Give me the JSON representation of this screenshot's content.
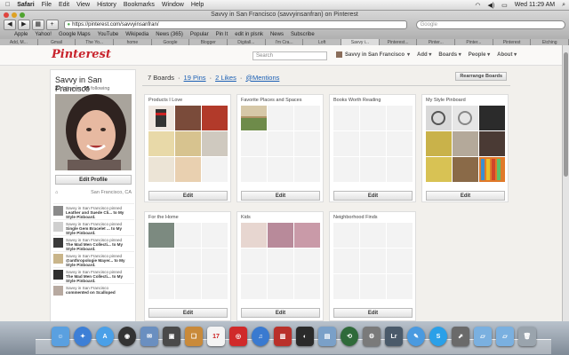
{
  "menubar": {
    "apple": "",
    "app": "Safari",
    "items": [
      "File",
      "Edit",
      "View",
      "History",
      "Bookmarks",
      "Window",
      "Help"
    ],
    "clock": "Wed 11:29 AM"
  },
  "window": {
    "title": "Savvy in San Francisco (savvyinsanfran) on Pinterest"
  },
  "browser": {
    "url": "https://pinterest.com/savvyinsanfran/",
    "search_placeholder": "Google",
    "bookmarks": [
      "Apple",
      "Yahoo!",
      "Google Maps",
      "YouTube",
      "Wikipedia",
      "News (365)",
      "Popular",
      "Pin It",
      "edit in plsnk",
      "News",
      "Subscribe"
    ],
    "tabs": [
      "Add, M...",
      "Gmail",
      "The Yo...",
      "home",
      "Google",
      "Blogger",
      "Digitall...",
      "I'm Cra...",
      "Loft",
      "Savvy i...",
      "Pinterest...",
      "Pinter...",
      "Pinter...",
      "Pinterest",
      "Etching"
    ]
  },
  "pinterest": {
    "logo": "Pinterest",
    "search_placeholder": "Search",
    "nav": {
      "user": "Savvy in San Francisco",
      "add": "Add",
      "boards": "Boards",
      "people": "People",
      "about": "About"
    }
  },
  "profile": {
    "name": "Savvy in San Francisco",
    "followers_count": "27",
    "followers_label": "followers",
    "following_count": "55",
    "following_label": "following",
    "edit_label": "Edit Profile",
    "location": "San Francisco, CA"
  },
  "activity": [
    {
      "line1": "Savvy in San Francisco pinned",
      "line2": "Leather and Suede Cli... to My",
      "line3": "Style Pinboard."
    },
    {
      "line1": "Savvy in San Francisco pinned",
      "line2": "Single Gem Bracelet ... to My",
      "line3": "Style Pinboard."
    },
    {
      "line1": "Savvy in San Francisco pinned",
      "line2": "The Mad Men Collecti... to My",
      "line3": "Style Pinboard."
    },
    {
      "line1": "Savvy in San Francisco pinned",
      "line2": "@anthropologie Mayer... to My",
      "line3": "Style Pinboard."
    },
    {
      "line1": "Savvy in San Francisco pinned",
      "line2": "The Mad Men Collecti... to My",
      "line3": "Style Pinboard."
    },
    {
      "line1": "Savvy in San Francisco",
      "line2": "commented on Scalloped",
      "line3": ""
    }
  ],
  "boardsbar": {
    "boards": "7 Boards",
    "pins": "19 Pins",
    "likes": "2 Likes",
    "mentions": "@Mentions",
    "rearrange": "Rearrange Boards"
  },
  "boards": [
    {
      "title": "Products I Love",
      "edit": "Edit"
    },
    {
      "title": "Favorite Places and Spaces",
      "edit": "Edit"
    },
    {
      "title": "Books Worth Reading",
      "edit": "Edit"
    },
    {
      "title": "My Style Pinboard",
      "edit": "Edit"
    },
    {
      "title": "For the Home",
      "edit": "Edit"
    },
    {
      "title": "Kids",
      "edit": "Edit"
    },
    {
      "title": "Neighborhood Finds",
      "edit": "Edit"
    }
  ],
  "dock": [
    "Finder",
    "Safari",
    "App Store",
    "Dashboard",
    "Mail",
    "iPhoto",
    "iBooks",
    "Calendar",
    "Photo Booth",
    "iTunes",
    "Photos",
    "Aperture",
    "Preview",
    "Time Machine",
    "Utility",
    "Lightroom",
    "Messages",
    "Skype",
    "Scripts",
    "Applications",
    "Documents",
    "Trash"
  ],
  "colors": {
    "pinterest_red": "#c8232c",
    "link_blue": "#1a5fb4"
  }
}
